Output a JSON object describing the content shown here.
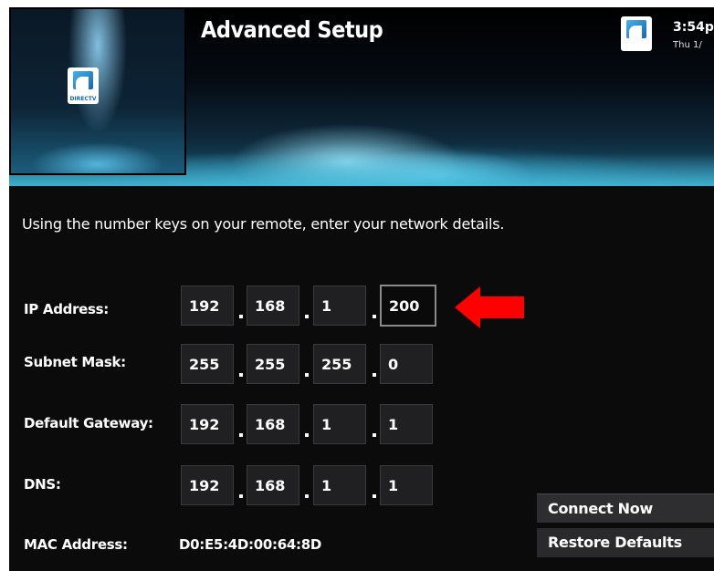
{
  "header": {
    "title": "Advanced Setup",
    "time": "3:54p",
    "date": "Thu 1/",
    "logo_text": "DIRECTV"
  },
  "instruction": "Using the number keys on your remote, enter your network details.",
  "fields": [
    {
      "label": "IP Address:",
      "octets": [
        "192",
        "168",
        "1",
        "200"
      ]
    },
    {
      "label": "Subnet Mask:",
      "octets": [
        "255",
        "255",
        "255",
        "0"
      ]
    },
    {
      "label": "Default Gateway:",
      "octets": [
        "192",
        "168",
        "1",
        "1"
      ]
    },
    {
      "label": "DNS:",
      "octets": [
        "192",
        "168",
        "1",
        "1"
      ]
    }
  ],
  "mac": {
    "label": "MAC Address:",
    "value": "D0:E5:4D:00:64:8D"
  },
  "buttons": {
    "connect": "Connect Now",
    "restore": "Restore Defaults"
  },
  "colors": {
    "arrow": "#ff0000",
    "background": "#0b0b0c",
    "field": "#202022"
  },
  "icons": {
    "arrow": "red-arrow-icon",
    "logo": "directv-logo-icon"
  }
}
